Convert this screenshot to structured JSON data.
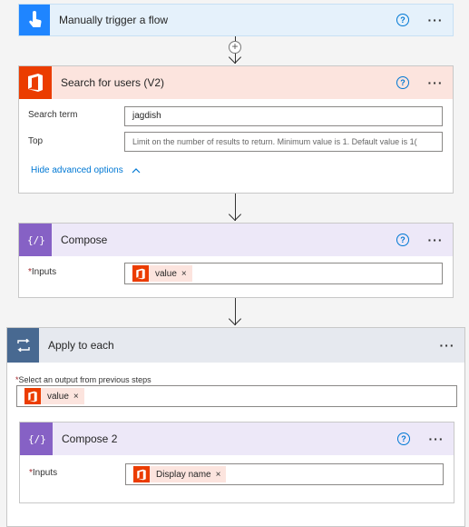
{
  "trigger": {
    "title": "Manually trigger a flow",
    "help_icon": "?",
    "more_icon": "···"
  },
  "connector1": {
    "insert_icon": "+"
  },
  "search_users": {
    "title": "Search for users (V2)",
    "help_icon": "?",
    "more_icon": "···",
    "search_term_label": "Search term",
    "search_term_value": "jagdish",
    "top_label": "Top",
    "top_placeholder": "Limit on the number of results to return. Minimum value is 1. Default value is 1(",
    "advanced_link": "Hide advanced options",
    "accent": "#eb3c00"
  },
  "compose": {
    "title": "Compose",
    "help_icon": "?",
    "more_icon": "···",
    "inputs_required": "*",
    "inputs_label": "Inputs",
    "token_label": "value",
    "token_remove": "×",
    "accent": "#8661c5"
  },
  "apply_each": {
    "title": "Apply to each",
    "more_icon": "···",
    "select_required": "*",
    "select_label": "Select an output from previous steps",
    "token_label": "value",
    "token_remove": "×",
    "accent": "#486991"
  },
  "compose2": {
    "title": "Compose 2",
    "help_icon": "?",
    "more_icon": "···",
    "inputs_required": "*",
    "inputs_label": "Inputs",
    "token_label": "Display name",
    "token_remove": "×"
  }
}
